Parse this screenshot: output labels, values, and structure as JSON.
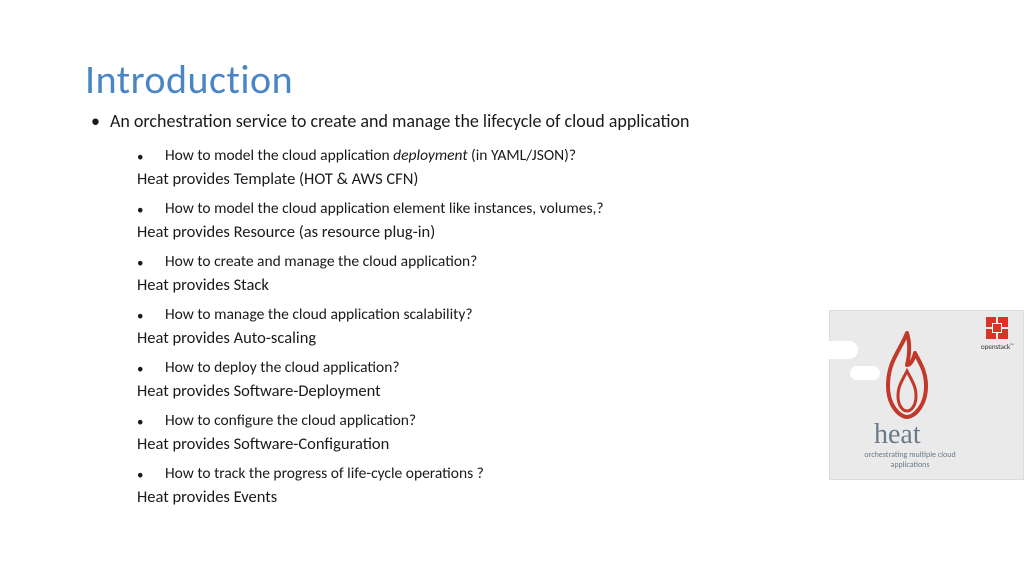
{
  "title": "Introduction",
  "intro": "An orchestration service to create and manage the lifecycle of cloud application",
  "items": [
    {
      "q_pre": "How to model the cloud application ",
      "q_em": "deployment",
      "q_post": " (in YAML/JSON)?",
      "a": "Heat provides Template (HOT & AWS CFN)"
    },
    {
      "q_pre": "How to model the cloud application element like instances, volumes,?",
      "q_em": "",
      "q_post": "",
      "a": "Heat provides Resource (as resource plug-in)"
    },
    {
      "q_pre": "How to create and manage the cloud application?",
      "q_em": "",
      "q_post": "",
      "a": "Heat provides Stack"
    },
    {
      "q_pre": "How to manage the cloud application scalability?",
      "q_em": "",
      "q_post": "",
      "a": "Heat provides Auto-scaling"
    },
    {
      "q_pre": "How to deploy the cloud application?",
      "q_em": "",
      "q_post": "",
      "a": "Heat provides Software-Deployment"
    },
    {
      "q_pre": "How to configure the cloud application?",
      "q_em": "",
      "q_post": "",
      "a": "Heat provides Software-Configuration"
    },
    {
      "q_pre": "How to track the progress of life-cycle operations ?",
      "q_em": "",
      "q_post": "",
      "a": "Heat provides  Events"
    }
  ],
  "logo": {
    "heat": "heat",
    "heat_sub": "orchestrating multiple cloud applications",
    "openstack": "openstack"
  }
}
